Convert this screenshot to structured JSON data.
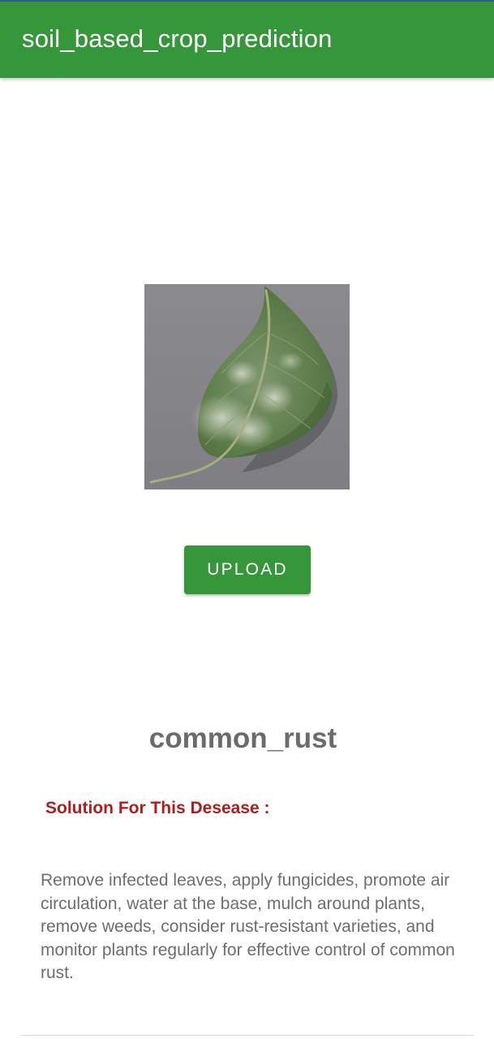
{
  "app_bar": {
    "title": "soil_based_crop_prediction",
    "color": "#35963a"
  },
  "main": {
    "image": {
      "icon": "leaf-photo",
      "description_colors": {
        "background": "#86858a",
        "leaf": "#5d7d4d"
      }
    },
    "upload_button": {
      "label": "UPLOAD"
    },
    "prediction": {
      "disease_name": "common_rust"
    },
    "solution": {
      "heading": "Solution For This Desease :",
      "heading_color": "#b01d1d",
      "text": "Remove infected leaves, apply fungicides, promote air circulation, water at the base, mulch around plants, remove weeds, consider rust-resistant varieties, and monitor plants regularly for effective control of common rust."
    }
  }
}
